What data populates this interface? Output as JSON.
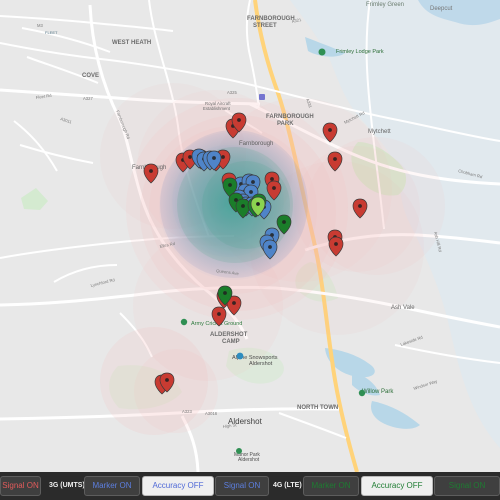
{
  "map_labels": {
    "fleet_sign": "FLEET",
    "west_heath": "WEST HEATH",
    "cove": "COVE",
    "farnborough_street": "FARNBOROUGH\nSTREET",
    "frimley_green": "Frimley Green",
    "deepcut": "Deepcut",
    "frimley_lodge_park": "Frimley Lodge Park",
    "farnborough_park": "FARNBOROUGH\nPARK",
    "mytchett": "Mytchett",
    "farnborough": "Farnborough",
    "farnborough_main": "Farnborough",
    "aldershot_camp": "ALDERSHOT\nCAMP",
    "army_cricket_ground": "Army Cricket Ground",
    "alpine_snowsports": "Alpine Snowsports\nAldershot",
    "ash_vale": "Ash Vale",
    "north_town": "NORTH TOWN",
    "willow_park": "Willow Park",
    "aldershot": "Aldershot",
    "manor_park": "Manor Park\nAldershot",
    "royal_aircraft": "Royal Aircraft\nEstablishment"
  },
  "road_labels": [
    "A327",
    "Fleet Rd",
    "A3011",
    "A325",
    "A323",
    "A321",
    "M3",
    "A331",
    "A3016",
    "Ash Hill Rd",
    "Lynchford Rd",
    "Queens Ave",
    "Farnborough Rd",
    "Elles Rd",
    "Mytchett Rd",
    "Chobham Rd",
    "Windsor Way",
    "Lakeside Rd",
    "High St"
  ],
  "toolbar": {
    "signal_on": "Signal ON",
    "label_3g": "3G (UMTS)",
    "marker_on_3g": "Marker ON",
    "accuracy_off_3g": "Accuracy OFF",
    "signal_on_3g": "Signal ON",
    "label_4g": "4G (LTE)",
    "marker_on_4g": "Marker ON",
    "accuracy_off_4g": "Accuracy OFF",
    "signal_on_4g": "Signal ON"
  },
  "colors": {
    "map_bg": "#e8e8e8",
    "road_major": "#ffffff",
    "road_minor": "#f7f7f7",
    "road_orange": "#ffd37a",
    "water": "#b8d7e8",
    "park": "#d4ead0",
    "accuracy_red": "#f4b7b6",
    "accuracy_blue": "#7fa6df",
    "accuracy_green": "#1f9e72",
    "marker_red": "#c83b32",
    "marker_blue": "#4f84c8",
    "marker_green": "#1b7d2a",
    "toolbar_bg": "#2b2b2b",
    "toolbar_btn_dark": "#3f3f3f",
    "toolbar_btn_light": "#efefef",
    "signal_red_text": "#e15b5b",
    "blue_text": "#5d7fe0",
    "green_text": "#1e7c32"
  },
  "icon_names": {
    "marker": "map-pin-icon",
    "park": "park-pin-icon",
    "station": "train-station-icon",
    "place": "place-pin-icon"
  },
  "markers": {
    "red": [
      {
        "name": "red-marker-1"
      },
      {
        "name": "red-marker-2"
      },
      {
        "name": "red-marker-3"
      },
      {
        "name": "red-marker-4"
      },
      {
        "name": "red-marker-5"
      },
      {
        "name": "red-marker-6"
      },
      {
        "name": "red-marker-7"
      },
      {
        "name": "red-marker-8"
      },
      {
        "name": "red-marker-9"
      },
      {
        "name": "red-marker-10"
      },
      {
        "name": "red-marker-11"
      },
      {
        "name": "red-marker-12"
      },
      {
        "name": "red-marker-13"
      },
      {
        "name": "red-marker-14"
      },
      {
        "name": "red-marker-15"
      },
      {
        "name": "red-marker-16"
      },
      {
        "name": "red-marker-17"
      },
      {
        "name": "red-marker-18"
      },
      {
        "name": "red-marker-19"
      },
      {
        "name": "red-marker-20"
      },
      {
        "name": "red-marker-21"
      }
    ],
    "blue": [
      {
        "name": "blue-marker-1"
      },
      {
        "name": "blue-marker-2"
      },
      {
        "name": "blue-marker-3"
      },
      {
        "name": "blue-marker-4"
      },
      {
        "name": "blue-marker-5"
      },
      {
        "name": "blue-marker-6"
      },
      {
        "name": "blue-marker-7"
      },
      {
        "name": "blue-marker-8"
      },
      {
        "name": "blue-marker-9"
      },
      {
        "name": "blue-marker-10"
      },
      {
        "name": "blue-marker-11"
      },
      {
        "name": "blue-marker-12"
      },
      {
        "name": "blue-marker-13"
      },
      {
        "name": "blue-marker-14"
      },
      {
        "name": "blue-marker-15"
      },
      {
        "name": "blue-marker-16"
      },
      {
        "name": "blue-marker-17"
      },
      {
        "name": "blue-marker-18"
      }
    ],
    "green": [
      {
        "name": "green-marker-1"
      },
      {
        "name": "green-marker-2"
      },
      {
        "name": "green-marker-3"
      },
      {
        "name": "green-marker-4"
      },
      {
        "name": "green-marker-5"
      },
      {
        "name": "green-marker-6"
      },
      {
        "name": "green-marker-7"
      }
    ]
  }
}
